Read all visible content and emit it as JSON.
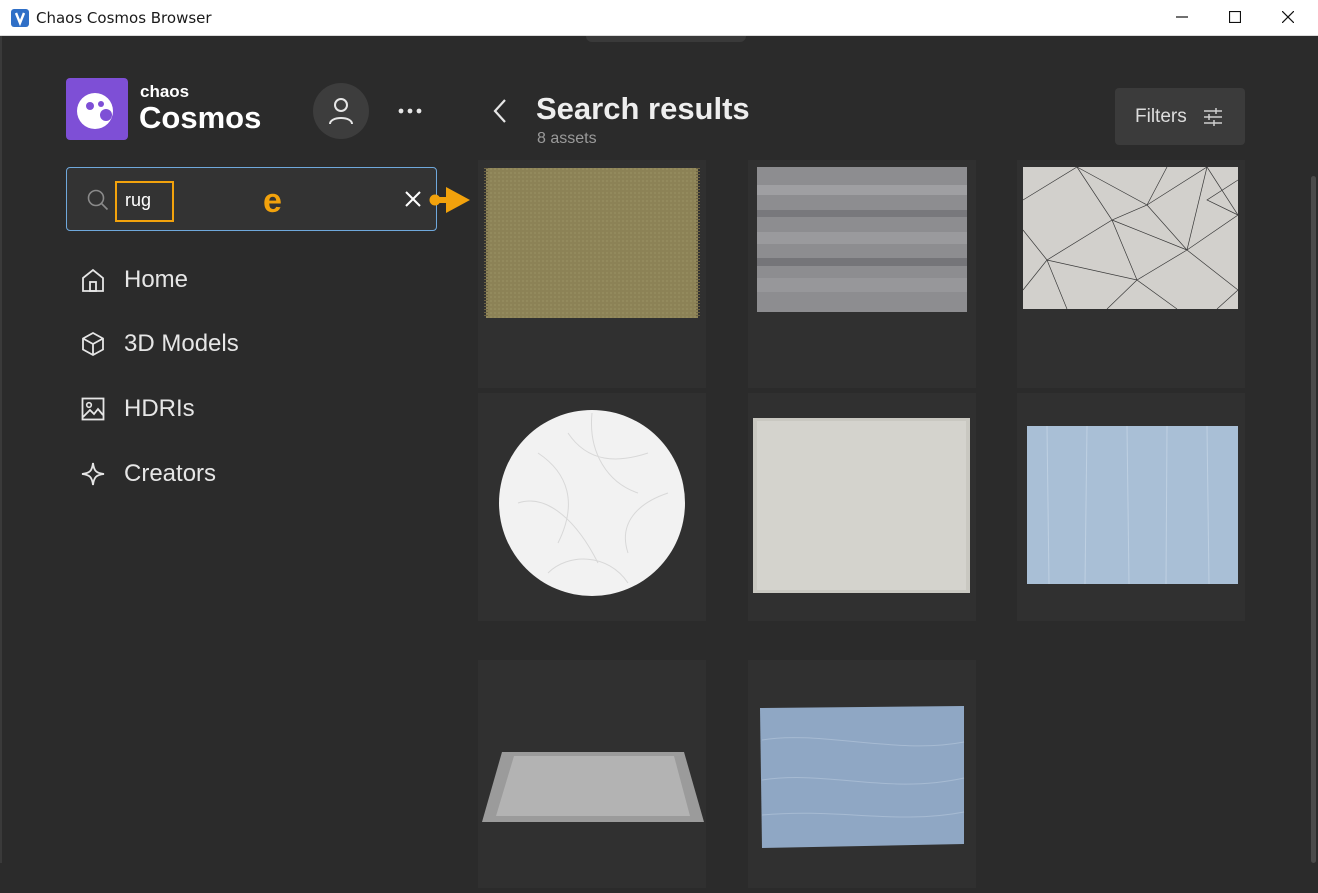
{
  "window": {
    "title": "Chaos Cosmos Browser",
    "icon": "chaos-app-icon",
    "controls": [
      "minimize",
      "maximize",
      "close"
    ]
  },
  "brand": {
    "small": "chaos",
    "big": "Cosmos",
    "accent_color": "#7e4fd6"
  },
  "header": {
    "account_icon": "user-icon",
    "more_icon": "ellipsis-icon"
  },
  "search": {
    "value": "rug",
    "annotation_mark": "e",
    "highlight_color": "#f2a20c",
    "border_color": "#6fa8dc"
  },
  "nav": {
    "items": [
      {
        "label": "Home",
        "icon": "home-icon"
      },
      {
        "label": "3D Models",
        "icon": "cube-icon"
      },
      {
        "label": "HDRIs",
        "icon": "image-icon"
      },
      {
        "label": "Creators",
        "icon": "sparkle-icon"
      }
    ]
  },
  "results": {
    "title": "Search results",
    "count": "8 assets",
    "filters_label": "Filters"
  },
  "assets": [
    {
      "name": "olive woven rug with fringe"
    },
    {
      "name": "grey distressed rug"
    },
    {
      "name": "white geometric line rug"
    },
    {
      "name": "white round leaf pattern rug"
    },
    {
      "name": "cream plain rug"
    },
    {
      "name": "light blue rug"
    },
    {
      "name": "grey rug in perspective"
    },
    {
      "name": "blue textured rug"
    }
  ]
}
